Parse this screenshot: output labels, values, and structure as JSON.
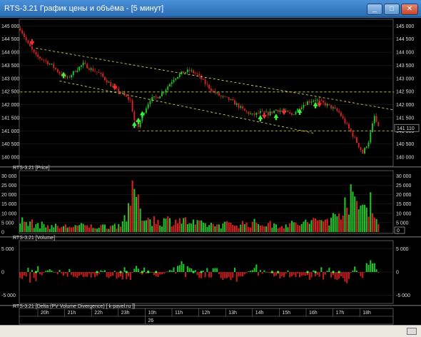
{
  "window": {
    "title": "RTS-3.21 График цены и объёма - [5 минут]",
    "minimize_label": "_",
    "maximize_label": "□",
    "close_label": "✕"
  },
  "chart_data": [
    {
      "type": "candlestick",
      "title": "RTS-3.21 [Price]",
      "ylim": [
        139700,
        145200
      ],
      "y_ticks": [
        "145 000",
        "144 500",
        "144 000",
        "143 500",
        "143 000",
        "142 500",
        "142 000",
        "141 500",
        "141 000",
        "140 500",
        "140 000"
      ],
      "current_price_label": "141 110",
      "current_price": 141110,
      "close_path": [
        [
          0,
          144900
        ],
        [
          4,
          144300
        ],
        [
          8,
          143850
        ],
        [
          12,
          143700
        ],
        [
          16,
          143500
        ],
        [
          20,
          143200
        ],
        [
          24,
          143000
        ],
        [
          28,
          143300
        ],
        [
          32,
          143550
        ],
        [
          36,
          143350
        ],
        [
          40,
          143200
        ],
        [
          44,
          142900
        ],
        [
          48,
          142600
        ],
        [
          52,
          142400
        ],
        [
          56,
          142150
        ],
        [
          58,
          141400
        ],
        [
          60,
          141150
        ],
        [
          62,
          141600
        ],
        [
          66,
          142200
        ],
        [
          70,
          142300
        ],
        [
          74,
          142600
        ],
        [
          78,
          143000
        ],
        [
          82,
          143200
        ],
        [
          86,
          143300
        ],
        [
          90,
          143150
        ],
        [
          94,
          142800
        ],
        [
          98,
          142500
        ],
        [
          102,
          142300
        ],
        [
          106,
          142200
        ],
        [
          110,
          142000
        ],
        [
          114,
          141750
        ],
        [
          118,
          141600
        ],
        [
          122,
          141700
        ],
        [
          126,
          141650
        ],
        [
          130,
          141800
        ],
        [
          134,
          141750
        ],
        [
          138,
          141600
        ],
        [
          142,
          141900
        ],
        [
          146,
          142100
        ],
        [
          150,
          142200
        ],
        [
          154,
          142050
        ],
        [
          158,
          141900
        ],
        [
          162,
          141700
        ],
        [
          166,
          141200
        ],
        [
          170,
          140700
        ],
        [
          174,
          140150
        ],
        [
          177,
          140600
        ],
        [
          180,
          141550
        ],
        [
          182,
          141110
        ]
      ],
      "buy_signals": [
        [
          22,
          143200
        ],
        [
          58,
          141300
        ],
        [
          60,
          141450
        ],
        [
          62,
          141700
        ],
        [
          122,
          141550
        ],
        [
          130,
          141600
        ],
        [
          142,
          141800
        ],
        [
          150,
          142050
        ]
      ],
      "sell_signals": [
        [
          6,
          144300
        ],
        [
          48,
          142600
        ],
        [
          124,
          141500
        ],
        [
          134,
          141650
        ],
        [
          152,
          141950
        ]
      ],
      "trendlines": [
        {
          "color": "#e8e860",
          "style": "dashed",
          "from": [
            8,
            144150
          ],
          "to": [
            190,
            141800
          ]
        },
        {
          "color": "#e8e860",
          "style": "dashed",
          "from": [
            20,
            142900
          ],
          "to": [
            150,
            140900
          ]
        },
        {
          "color": "#e8e860",
          "style": "dashed",
          "from": [
            0,
            142480
          ],
          "to": [
            190,
            142480
          ]
        },
        {
          "color": "#e8e860",
          "style": "dashed",
          "from": [
            60,
            141000
          ],
          "to": [
            190,
            141000
          ]
        }
      ],
      "time_labels": [
        "20h",
        "21h",
        "22h",
        "23h",
        "10h",
        "11h",
        "12h",
        "13h",
        "14h",
        "15h",
        "16h",
        "17h",
        "18h"
      ],
      "date_label": "26"
    },
    {
      "type": "bar",
      "title": "RTS-3.21 [Volume]",
      "ylim": [
        0,
        32000
      ],
      "y_ticks": [
        "30 000",
        "25 000",
        "20 000",
        "15 000",
        "10 000",
        "5 000",
        "0"
      ],
      "current_value_label": "0",
      "volume_profile": [
        [
          0,
          6000
        ],
        [
          10,
          4000
        ],
        [
          20,
          3000
        ],
        [
          30,
          3500
        ],
        [
          40,
          3000
        ],
        [
          50,
          4000
        ],
        [
          56,
          12000
        ],
        [
          58,
          29000
        ],
        [
          60,
          14000
        ],
        [
          64,
          8000
        ],
        [
          70,
          6000
        ],
        [
          80,
          7000
        ],
        [
          90,
          4500
        ],
        [
          100,
          4000
        ],
        [
          110,
          4500
        ],
        [
          120,
          5000
        ],
        [
          130,
          4000
        ],
        [
          140,
          4500
        ],
        [
          150,
          6000
        ],
        [
          160,
          8000
        ],
        [
          166,
          20000
        ],
        [
          170,
          16000
        ],
        [
          174,
          14000
        ],
        [
          178,
          19000
        ],
        [
          182,
          4000
        ]
      ]
    },
    {
      "type": "bar",
      "title": "RTS-3.21 [Delta (PV Volume Divergence) [ k-pavel.ru ]]",
      "ylim": [
        -6500,
        6500
      ],
      "y_ticks": [
        "5 000",
        "0",
        "-5 000"
      ],
      "right_ticks": [
        "5 000",
        "0",
        "-5 000"
      ],
      "delta_profile": [
        [
          0,
          -1200
        ],
        [
          8,
          -2600
        ],
        [
          14,
          800
        ],
        [
          20,
          -700
        ],
        [
          30,
          -1200
        ],
        [
          40,
          -900
        ],
        [
          50,
          -1500
        ],
        [
          56,
          -2200
        ],
        [
          58,
          1800
        ],
        [
          62,
          1200
        ],
        [
          70,
          -1200
        ],
        [
          80,
          1600
        ],
        [
          84,
          2600
        ],
        [
          90,
          -1300
        ],
        [
          100,
          -1500
        ],
        [
          110,
          -1800
        ],
        [
          120,
          1400
        ],
        [
          130,
          -1200
        ],
        [
          140,
          -1000
        ],
        [
          150,
          -1600
        ],
        [
          160,
          -1300
        ],
        [
          166,
          -2400
        ],
        [
          170,
          1400
        ],
        [
          174,
          -1900
        ],
        [
          178,
          5300
        ],
        [
          180,
          2400
        ],
        [
          182,
          -300
        ]
      ]
    }
  ]
}
